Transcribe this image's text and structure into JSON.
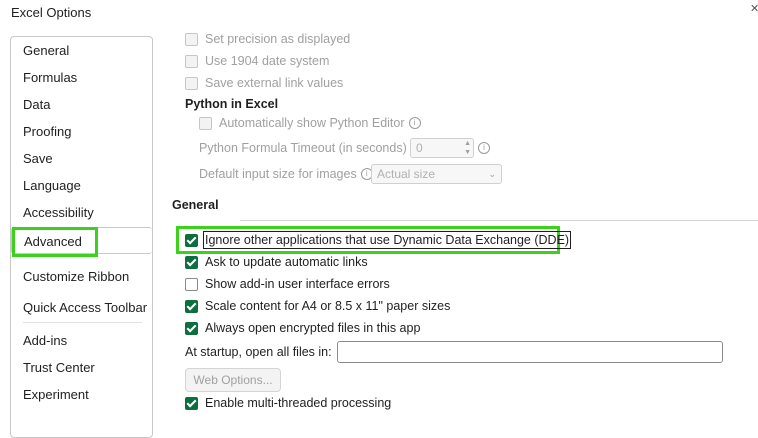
{
  "window": {
    "title": "Excel Options"
  },
  "nav": {
    "items": [
      {
        "label": "General"
      },
      {
        "label": "Formulas"
      },
      {
        "label": "Data"
      },
      {
        "label": "Proofing"
      },
      {
        "label": "Save"
      },
      {
        "label": "Language"
      },
      {
        "label": "Accessibility"
      },
      {
        "label": "Advanced"
      },
      {
        "label": "Customize Ribbon"
      },
      {
        "label": "Quick Access Toolbar"
      },
      {
        "label": "Add-ins"
      },
      {
        "label": "Trust Center"
      },
      {
        "label": "Experiment"
      }
    ],
    "selected": "Advanced"
  },
  "calc": {
    "set_precision": "Set precision as displayed",
    "date_1904": "Use 1904 date system",
    "save_links": "Save external link values"
  },
  "python": {
    "heading": "Python in Excel",
    "auto_show": "Automatically show Python Editor",
    "timeout_label": "Python Formula Timeout (in seconds)",
    "timeout_value": "0",
    "default_size_label": "Default input size for images",
    "default_size_value": "Actual size"
  },
  "general": {
    "heading": "General",
    "ignore_dde": "Ignore other applications that use Dynamic Data Exchange (DDE)",
    "ask_update": "Ask to update automatic links",
    "show_addin_errors": "Show add-in user interface errors",
    "scale_content": "Scale content for A4 or 8.5 x 11\" paper sizes",
    "always_open_encrypted": "Always open encrypted files in this app",
    "startup_label": "At startup, open all files in:",
    "startup_value": "",
    "web_options": "Web Options...",
    "multithread": "Enable multi-threaded processing"
  },
  "colors": {
    "highlight": "#3cd21c",
    "checkbox": "#0f6e3f"
  }
}
